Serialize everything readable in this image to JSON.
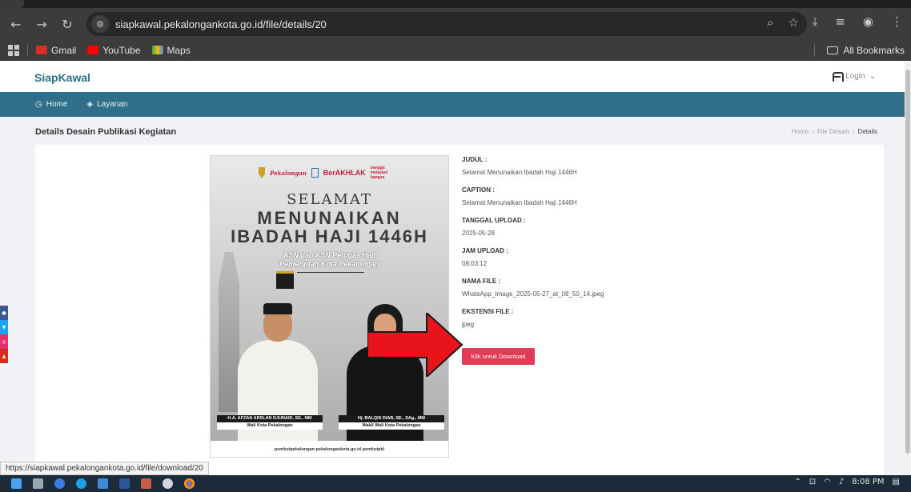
{
  "browser": {
    "url": "siapkawal.pekalongankota.go.id/file/details/20",
    "bookmarks": [
      "Gmail",
      "YouTube",
      "Maps"
    ],
    "all_bookmarks": "All Bookmarks",
    "status_url": "https://siapkawal.pekalongankota.go.id/file/download/20"
  },
  "site": {
    "brand": "SiapKawal",
    "login": "Login",
    "nav": [
      "Home",
      "Layanan"
    ]
  },
  "page": {
    "title": "Details Desain Publikasi Kegiatan",
    "breadcrumb": [
      "Home",
      "File Desain",
      "Details"
    ]
  },
  "poster": {
    "logo_text": "Pekalongan",
    "logo_berakhlak": "BerAKHLAK",
    "logo_bangga": "bangga melayani bangsa",
    "line1": "SELAMAT",
    "line2": "MENUNAIKAN",
    "line3": "IBADAH HAJI 1446H",
    "sub1": "ASN dan ASN Petugas Haji",
    "sub2": "Pemerintah Kota Pekalongan",
    "person1_name": "H.A. AFZAN ARSLAN DJUNAID, SE., MM",
    "person1_title": "Wali Kota Pekalongan",
    "person2_name": "Hj. BALQIS DIAB, SE., SAg., MM",
    "person2_title": "Wakil Wali Kota Pekalongan",
    "footer": "pemkotpekalongan   pekalongankota.go.id   pemkotpkl"
  },
  "details": {
    "judul_label": "JUDUL :",
    "judul": "Selamat Menunaikan Ibadah Haji 1446H",
    "caption_label": "CAPTION :",
    "caption": "Selamat Menunaikan Ibadah Haji 1446H",
    "tanggal_label": "TANGGAL UPLOAD :",
    "tanggal": "2025-05-28",
    "jam_label": "JAM UPLOAD :",
    "jam": "08:03:12",
    "nama_label": "NAMA FILE :",
    "nama": "WhatsApp_Image_2025-05-27_at_08_50_14.jpeg",
    "ekstensi_label": "EKSTENSI FILE :",
    "ekstensi": "jpeg",
    "download_label": "Klik untuk Download"
  },
  "taskbar": {
    "time": "8:08 PM"
  },
  "colors": {
    "brand": "#2d6f8c",
    "navbar": "#306f89",
    "download": "#e23b55",
    "arrow": "#e8141b"
  }
}
